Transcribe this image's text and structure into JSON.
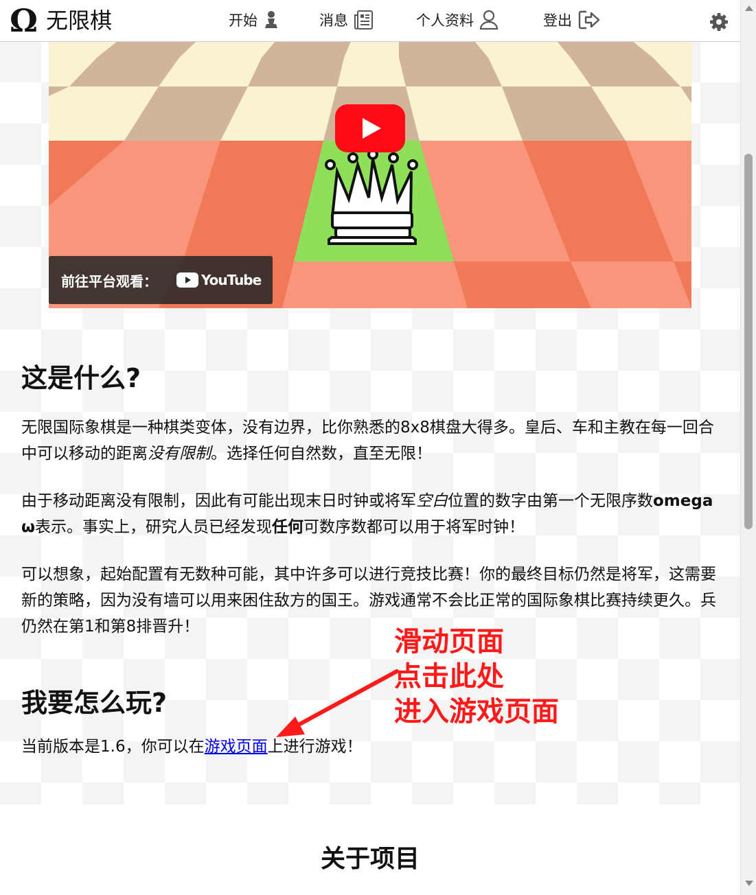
{
  "header": {
    "logo_mark": "Ω",
    "app_title": "无限棋",
    "nav": [
      {
        "label": "开始",
        "icon": "pawn-icon"
      },
      {
        "label": "消息",
        "icon": "newspaper-icon"
      },
      {
        "label": "个人资料",
        "icon": "user-icon"
      },
      {
        "label": "登出",
        "icon": "logout-icon"
      }
    ],
    "settings_icon": "gear-icon"
  },
  "video": {
    "watch_on_label": "前往平台观看：",
    "platform_label": "YouTube",
    "play_icon": "play-icon",
    "colors": {
      "youtube_red": "#ff0000",
      "board_orange": "#f08060",
      "board_cream": "#fbf2d3",
      "highlight_green": "#8ee05a"
    }
  },
  "section_what": {
    "title": "这是什么?",
    "p1_a": "无限国际象棋是一种棋类变体，没有边界，比你熟悉的8x8棋盘大得多。皇后、车和主教在每一回合中可以移动的距离",
    "p1_em": "没有限制",
    "p1_b": "。选择任何自然数，直至无限！",
    "p2_a": "由于移动距离没有限制，因此有可能出现末日时钟或将军",
    "p2_em": "空白",
    "p2_b": "位置的数字由第一个无限序数",
    "p2_strong1": "omega ω",
    "p2_c": "表示。事实上，研究人员已经发现",
    "p2_strong2": "任何",
    "p2_d": "可数序数都可以用于将军时钟！",
    "p3": "可以想象，起始配置有无数种可能，其中许多可以进行竞技比赛！你的最终目标仍然是将军，这需要新的策略，因为没有墙可以用来困住敌方的国王。游戏通常不会比正常的国际象棋比赛持续更久。兵仍然在第1和第8排晋升！"
  },
  "section_how": {
    "title": "我要怎么玩?",
    "p_a": "当前版本是1.6，你可以在",
    "link": "游戏页面",
    "p_b": "上进行游戏！"
  },
  "annotation": {
    "line1": "滑动页面",
    "line2": "点击此处",
    "line3": "进入游戏页面",
    "color": "#ff1a1a"
  },
  "about": {
    "title": "关于项目"
  }
}
